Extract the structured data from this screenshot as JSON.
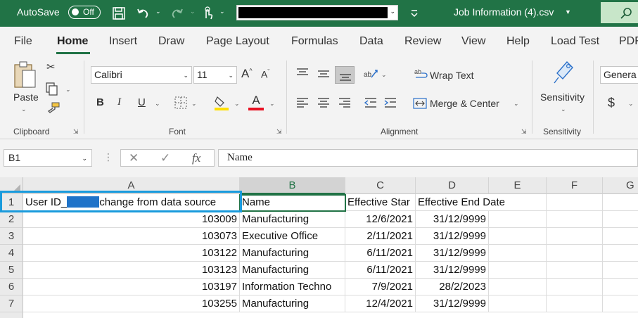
{
  "titlebar": {
    "autosave_label": "AutoSave",
    "autosave_state": "Off",
    "file_name": "Job Information (4).csv",
    "icons": [
      "save-icon",
      "undo-icon",
      "redo-icon",
      "touch-mode-icon",
      "customize-toolbar-icon",
      "search-icon"
    ],
    "color": "#217346"
  },
  "ribbon_tabs": [
    "File",
    "Home",
    "Insert",
    "Draw",
    "Page Layout",
    "Formulas",
    "Data",
    "Review",
    "View",
    "Help",
    "Load Test",
    "PDF"
  ],
  "active_tab": "Home",
  "clipboard": {
    "paste_label": "Paste",
    "group_label": "Clipboard"
  },
  "font": {
    "family": "Calibri",
    "size": "11",
    "group_label": "Font",
    "bold": "B",
    "italic": "I",
    "underline": "U",
    "grow": "A",
    "shrink": "A",
    "font_color": "A"
  },
  "alignment": {
    "wrap_text": "Wrap Text",
    "merge_center": "Merge & Center",
    "group_label": "Alignment"
  },
  "sensitivity": {
    "button_label": "Sensitivity",
    "group_label": "Sensitivity"
  },
  "number": {
    "format": "Genera",
    "currency": "$"
  },
  "formula_bar": {
    "name_box": "B1",
    "fx": "fx",
    "cancel": "✕",
    "enter": "✓",
    "value": "Name"
  },
  "grid": {
    "columns": [
      "A",
      "B",
      "C",
      "D",
      "E",
      "F",
      "G"
    ],
    "rows": [
      {
        "num": "1",
        "a_prefix": "User ID_",
        "a_suffix": "change from data source",
        "b": "Name",
        "c": "Effective Star",
        "d": "Effective End Date"
      },
      {
        "num": "2",
        "a": "103009",
        "b": "Manufacturing",
        "c": "12/6/2021",
        "d": "31/12/9999"
      },
      {
        "num": "3",
        "a": "103073",
        "b": "Executive Office",
        "c": "2/11/2021",
        "d": "31/12/9999"
      },
      {
        "num": "4",
        "a": "103122",
        "b": "Manufacturing",
        "c": "6/11/2021",
        "d": "31/12/9999"
      },
      {
        "num": "5",
        "a": "103123",
        "b": "Manufacturing",
        "c": "6/11/2021",
        "d": "31/12/9999"
      },
      {
        "num": "6",
        "a": "103197",
        "b": "Information Techno",
        "c": "7/9/2021",
        "d": "28/2/2023"
      },
      {
        "num": "7",
        "a": "103255",
        "b": "Manufacturing",
        "c": "12/4/2021",
        "d": "31/12/9999"
      }
    ],
    "selected_cell": "B1",
    "accent": "#217346",
    "highlight": "#1a9bdc"
  }
}
